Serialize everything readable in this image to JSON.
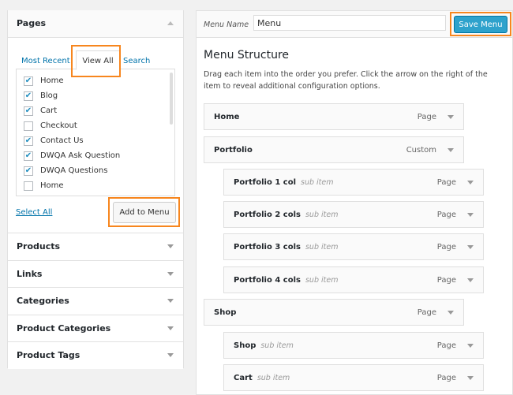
{
  "pages_box": {
    "title": "Pages",
    "tabs": [
      "Most Recent",
      "View All",
      "Search"
    ],
    "active_tab": "View All",
    "items": [
      {
        "label": "Home",
        "checked": true
      },
      {
        "label": "Blog",
        "checked": true
      },
      {
        "label": "Cart",
        "checked": true
      },
      {
        "label": "Checkout",
        "checked": false
      },
      {
        "label": "Contact Us",
        "checked": true
      },
      {
        "label": "DWQA Ask Question",
        "checked": true
      },
      {
        "label": "DWQA Questions",
        "checked": true
      },
      {
        "label": "Home",
        "checked": false
      }
    ],
    "select_all": "Select All",
    "add_button": "Add to Menu"
  },
  "sections": [
    "Products",
    "Links",
    "Categories",
    "Product Categories",
    "Product Tags"
  ],
  "menu": {
    "name_label": "Menu Name",
    "name_value": "Menu",
    "save_button": "Save Menu",
    "structure_title": "Menu Structure",
    "description": "Drag each item into the order you prefer. Click the arrow on the right of the item to reveal additional configuration options.",
    "sub_label": "sub item",
    "items": [
      {
        "title": "Home",
        "type": "Page",
        "depth": 0
      },
      {
        "title": "Portfolio",
        "type": "Custom",
        "depth": 0
      },
      {
        "title": "Portfolio 1 col",
        "type": "Page",
        "depth": 1
      },
      {
        "title": "Portfolio 2 cols",
        "type": "Page",
        "depth": 1
      },
      {
        "title": "Portfolio 3 cols",
        "type": "Page",
        "depth": 1
      },
      {
        "title": "Portfolio 4 cols",
        "type": "Page",
        "depth": 1
      },
      {
        "title": "Shop",
        "type": "Page",
        "depth": 0
      },
      {
        "title": "Shop",
        "type": "Page",
        "depth": 1
      },
      {
        "title": "Cart",
        "type": "Page",
        "depth": 1
      }
    ]
  },
  "colors": {
    "primary": "#2ea2cc",
    "highlight": "#f7861e",
    "link": "#0073aa"
  }
}
